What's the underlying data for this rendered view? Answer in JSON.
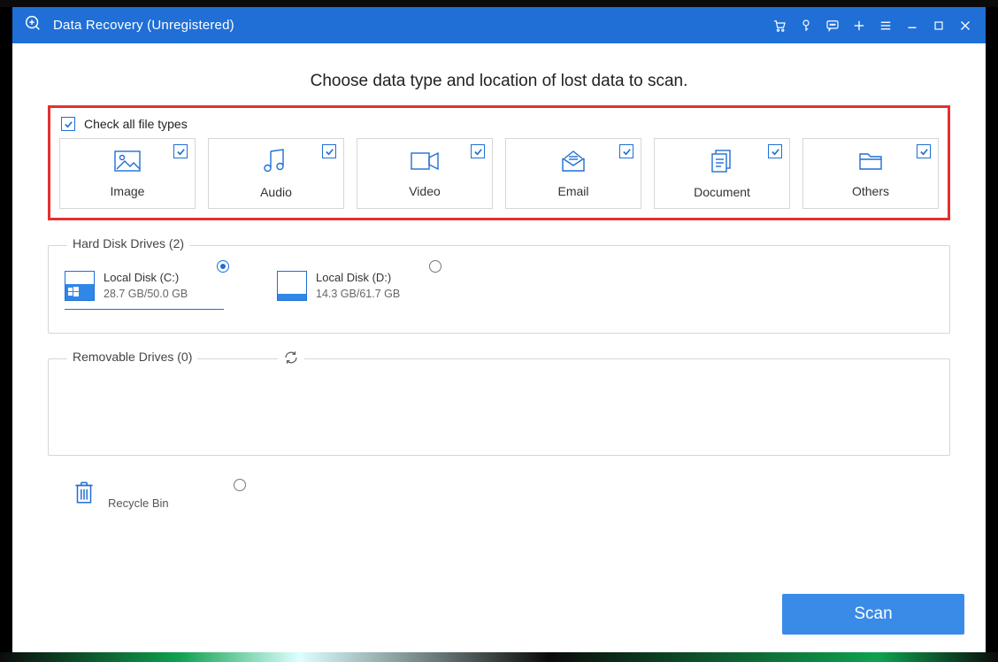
{
  "titlebar": {
    "title": "Data Recovery (Unregistered)"
  },
  "heading": "Choose data type and location of lost data to scan.",
  "checkAllLabel": "Check all file types",
  "fileTypes": [
    {
      "label": "Image",
      "icon": "image-icon",
      "checked": true
    },
    {
      "label": "Audio",
      "icon": "audio-icon",
      "checked": true
    },
    {
      "label": "Video",
      "icon": "video-icon",
      "checked": true
    },
    {
      "label": "Email",
      "icon": "email-icon",
      "checked": true
    },
    {
      "label": "Document",
      "icon": "document-icon",
      "checked": true
    },
    {
      "label": "Others",
      "icon": "others-icon",
      "checked": true
    }
  ],
  "hardDisk": {
    "legend": "Hard Disk Drives (2)",
    "drives": [
      {
        "name": "Local Disk (C:)",
        "size": "28.7 GB/50.0 GB",
        "fillPct": 57,
        "selected": true,
        "hasWinLogo": true
      },
      {
        "name": "Local Disk (D:)",
        "size": "14.3 GB/61.7 GB",
        "fillPct": 23,
        "selected": false,
        "hasWinLogo": false
      }
    ]
  },
  "removable": {
    "legend": "Removable Drives (0)"
  },
  "recycle": {
    "label": "Recycle Bin",
    "selected": false
  },
  "scanLabel": "Scan"
}
